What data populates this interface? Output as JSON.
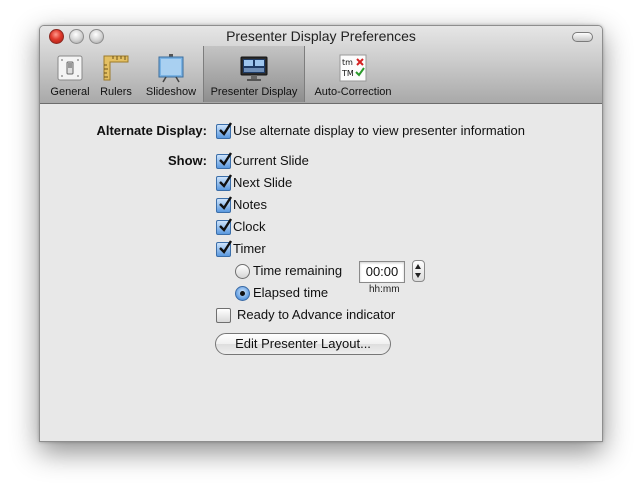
{
  "window": {
    "title": "Presenter Display Preferences"
  },
  "toolbar": {
    "items": [
      {
        "label": "General",
        "icon": "general-switch-icon"
      },
      {
        "label": "Rulers",
        "icon": "rulers-icon"
      },
      {
        "label": "Slideshow",
        "icon": "slideshow-screen-icon"
      },
      {
        "label": "Presenter Display",
        "icon": "presenter-display-icon",
        "selected": true
      },
      {
        "label": "Auto-Correction",
        "icon": "auto-correction-icon"
      }
    ]
  },
  "prefs": {
    "alternate_display": {
      "label": "Alternate Display:",
      "option": "Use alternate display to view presenter information",
      "checked": true
    },
    "show": {
      "label": "Show:",
      "current_slide": {
        "label": "Current Slide",
        "checked": true
      },
      "next_slide": {
        "label": "Next Slide",
        "checked": true
      },
      "notes": {
        "label": "Notes",
        "checked": true
      },
      "clock": {
        "label": "Clock",
        "checked": true
      },
      "timer": {
        "label": "Timer",
        "checked": true
      }
    },
    "timer_mode": {
      "time_remaining": {
        "label": "Time remaining",
        "selected": false
      },
      "elapsed_time": {
        "label": "Elapsed time",
        "selected": true
      },
      "time_value": "00:00",
      "time_format": "hh:mm"
    },
    "ready_indicator": {
      "label": "Ready to Advance indicator",
      "checked": false
    },
    "edit_layout_button": "Edit Presenter Layout..."
  },
  "colors": {
    "checkbox_accent": "#5a98de",
    "toolbar_selected": "#9a9a9a"
  }
}
